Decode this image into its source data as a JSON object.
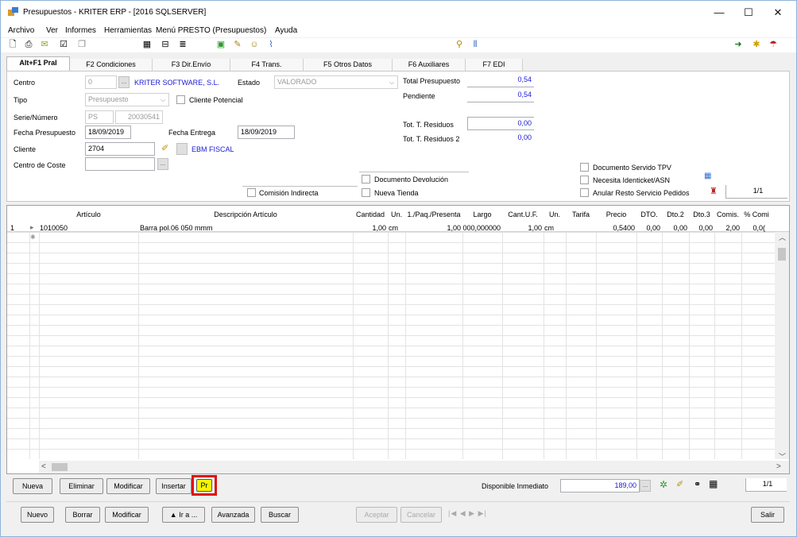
{
  "window": {
    "title": "Presupuestos - KRITER ERP - [2016 SQLSERVER]",
    "minimize": "—",
    "maximize": "☐",
    "close": "✕"
  },
  "menu": [
    "Archivo",
    "Ver",
    "Informes",
    "Herramientas",
    "Menú PRESTO (Presupuestos)",
    "Ayuda"
  ],
  "tabs": [
    "Alt+F1 Pral",
    "F2 Condiciones",
    "F3 Dir.Envío",
    "F4 Trans.",
    "F5 Otros Datos",
    "F6 Auxiliares",
    "F7 EDI"
  ],
  "form": {
    "centro_label": "Centro",
    "centro_value": "0",
    "centro_name": "KRITER SOFTWARE, S.L.",
    "estado_label": "Estado",
    "estado_value": "VALORADO",
    "tipo_label": "Tipo",
    "tipo_value": "Presupuesto",
    "cliente_potencial_label": "Cliente Potencial",
    "serie_label": "Serie/Número",
    "serie_value": "PS",
    "numero_value": "20030541",
    "fecha_presupuesto_label": "Fecha Presupuesto",
    "fecha_presupuesto_value": "18/09/2019",
    "fecha_entrega_label": "Fecha Entrega",
    "fecha_entrega_value": "18/09/2019",
    "cliente_label": "Cliente",
    "cliente_value": "2704",
    "cliente_name": "EBM FISCAL",
    "centro_coste_label": "Centro de Coste",
    "total_label": "Total Presupuesto",
    "total_value": "0,54",
    "pendiente_label": "Pendiente",
    "pendiente_value": "0,54",
    "residuos_label": "Tot. T. Residuos",
    "residuos_value": "0,00",
    "residuos2_label": "Tot. T. Residuos 2",
    "residuos2_value": "0,00",
    "doc_devolucion": "Documento Devolución",
    "comision_indirecta": "Comisión Indirecta",
    "nueva_tienda": "Nueva Tienda",
    "doc_servido_tpv": "Documento Servido TPV",
    "necesita_identicket": "Necesita Identicket/ASN",
    "anular_resto": "Anular Resto Servicio Pedidos",
    "page": "1/1"
  },
  "grid": {
    "columns": [
      "Artículo",
      "Descripción Artículo",
      "Cantidad",
      "Un.",
      "1./Paq./Presenta",
      "Largo",
      "Cant.U.F.",
      "Un.",
      "Tarifa",
      "Precio",
      "DTO.",
      "Dto.2",
      "Dto.3",
      "Comis.",
      "% Comi"
    ],
    "rows": [
      {
        "num": "1",
        "articulo": "1010050",
        "descripcion": "Barra pol.06 050 mmm",
        "cantidad": "1,00",
        "un": "cm",
        "paq": "1,00",
        "largo": "000,000000",
        "cantuf": "1,00",
        "un2": "cm",
        "tarifa": "",
        "precio": "0,5400",
        "dto": "0,00",
        "dto2": "0,00",
        "dto3": "0,00",
        "comis": "2,00",
        "pcomi": "0,0("
      }
    ]
  },
  "line_buttons": [
    "Nueva",
    "Eliminar",
    "Modificar",
    "Insertar",
    "Pr"
  ],
  "disponible_label": "Disponible Inmediato",
  "disponible_value": "189,00",
  "line_page": "1/1",
  "bottom_buttons": [
    "Nuevo",
    "Borrar",
    "Modificar",
    "▲ Ir a ...",
    "Avanzada",
    "Buscar",
    "Aceptar",
    "Cancelar",
    "Salir"
  ],
  "colors": {
    "accent": "#1a1ad0",
    "highlight_border": "#e01010",
    "highlight_fill": "#f5f500"
  }
}
